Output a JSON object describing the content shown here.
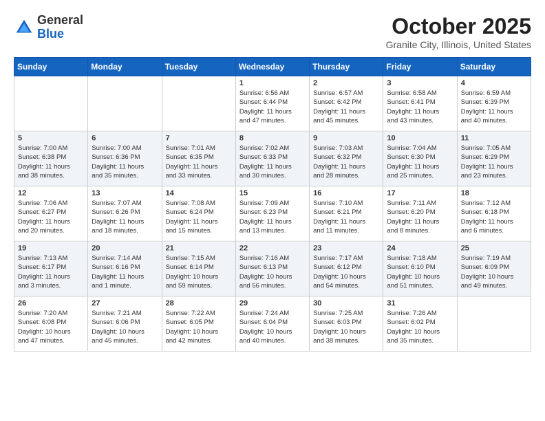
{
  "header": {
    "logo": {
      "general": "General",
      "blue": "Blue"
    },
    "title": "October 2025",
    "location": "Granite City, Illinois, United States"
  },
  "calendar": {
    "days_of_week": [
      "Sunday",
      "Monday",
      "Tuesday",
      "Wednesday",
      "Thursday",
      "Friday",
      "Saturday"
    ],
    "weeks": [
      [
        {
          "day": "",
          "info": ""
        },
        {
          "day": "",
          "info": ""
        },
        {
          "day": "",
          "info": ""
        },
        {
          "day": "1",
          "info": "Sunrise: 6:56 AM\nSunset: 6:44 PM\nDaylight: 11 hours\nand 47 minutes."
        },
        {
          "day": "2",
          "info": "Sunrise: 6:57 AM\nSunset: 6:42 PM\nDaylight: 11 hours\nand 45 minutes."
        },
        {
          "day": "3",
          "info": "Sunrise: 6:58 AM\nSunset: 6:41 PM\nDaylight: 11 hours\nand 43 minutes."
        },
        {
          "day": "4",
          "info": "Sunrise: 6:59 AM\nSunset: 6:39 PM\nDaylight: 11 hours\nand 40 minutes."
        }
      ],
      [
        {
          "day": "5",
          "info": "Sunrise: 7:00 AM\nSunset: 6:38 PM\nDaylight: 11 hours\nand 38 minutes."
        },
        {
          "day": "6",
          "info": "Sunrise: 7:00 AM\nSunset: 6:36 PM\nDaylight: 11 hours\nand 35 minutes."
        },
        {
          "day": "7",
          "info": "Sunrise: 7:01 AM\nSunset: 6:35 PM\nDaylight: 11 hours\nand 33 minutes."
        },
        {
          "day": "8",
          "info": "Sunrise: 7:02 AM\nSunset: 6:33 PM\nDaylight: 11 hours\nand 30 minutes."
        },
        {
          "day": "9",
          "info": "Sunrise: 7:03 AM\nSunset: 6:32 PM\nDaylight: 11 hours\nand 28 minutes."
        },
        {
          "day": "10",
          "info": "Sunrise: 7:04 AM\nSunset: 6:30 PM\nDaylight: 11 hours\nand 25 minutes."
        },
        {
          "day": "11",
          "info": "Sunrise: 7:05 AM\nSunset: 6:29 PM\nDaylight: 11 hours\nand 23 minutes."
        }
      ],
      [
        {
          "day": "12",
          "info": "Sunrise: 7:06 AM\nSunset: 6:27 PM\nDaylight: 11 hours\nand 20 minutes."
        },
        {
          "day": "13",
          "info": "Sunrise: 7:07 AM\nSunset: 6:26 PM\nDaylight: 11 hours\nand 18 minutes."
        },
        {
          "day": "14",
          "info": "Sunrise: 7:08 AM\nSunset: 6:24 PM\nDaylight: 11 hours\nand 15 minutes."
        },
        {
          "day": "15",
          "info": "Sunrise: 7:09 AM\nSunset: 6:23 PM\nDaylight: 11 hours\nand 13 minutes."
        },
        {
          "day": "16",
          "info": "Sunrise: 7:10 AM\nSunset: 6:21 PM\nDaylight: 11 hours\nand 11 minutes."
        },
        {
          "day": "17",
          "info": "Sunrise: 7:11 AM\nSunset: 6:20 PM\nDaylight: 11 hours\nand 8 minutes."
        },
        {
          "day": "18",
          "info": "Sunrise: 7:12 AM\nSunset: 6:18 PM\nDaylight: 11 hours\nand 6 minutes."
        }
      ],
      [
        {
          "day": "19",
          "info": "Sunrise: 7:13 AM\nSunset: 6:17 PM\nDaylight: 11 hours\nand 3 minutes."
        },
        {
          "day": "20",
          "info": "Sunrise: 7:14 AM\nSunset: 6:16 PM\nDaylight: 11 hours\nand 1 minute."
        },
        {
          "day": "21",
          "info": "Sunrise: 7:15 AM\nSunset: 6:14 PM\nDaylight: 10 hours\nand 59 minutes."
        },
        {
          "day": "22",
          "info": "Sunrise: 7:16 AM\nSunset: 6:13 PM\nDaylight: 10 hours\nand 56 minutes."
        },
        {
          "day": "23",
          "info": "Sunrise: 7:17 AM\nSunset: 6:12 PM\nDaylight: 10 hours\nand 54 minutes."
        },
        {
          "day": "24",
          "info": "Sunrise: 7:18 AM\nSunset: 6:10 PM\nDaylight: 10 hours\nand 51 minutes."
        },
        {
          "day": "25",
          "info": "Sunrise: 7:19 AM\nSunset: 6:09 PM\nDaylight: 10 hours\nand 49 minutes."
        }
      ],
      [
        {
          "day": "26",
          "info": "Sunrise: 7:20 AM\nSunset: 6:08 PM\nDaylight: 10 hours\nand 47 minutes."
        },
        {
          "day": "27",
          "info": "Sunrise: 7:21 AM\nSunset: 6:06 PM\nDaylight: 10 hours\nand 45 minutes."
        },
        {
          "day": "28",
          "info": "Sunrise: 7:22 AM\nSunset: 6:05 PM\nDaylight: 10 hours\nand 42 minutes."
        },
        {
          "day": "29",
          "info": "Sunrise: 7:24 AM\nSunset: 6:04 PM\nDaylight: 10 hours\nand 40 minutes."
        },
        {
          "day": "30",
          "info": "Sunrise: 7:25 AM\nSunset: 6:03 PM\nDaylight: 10 hours\nand 38 minutes."
        },
        {
          "day": "31",
          "info": "Sunrise: 7:26 AM\nSunset: 6:02 PM\nDaylight: 10 hours\nand 35 minutes."
        },
        {
          "day": "",
          "info": ""
        }
      ]
    ]
  }
}
